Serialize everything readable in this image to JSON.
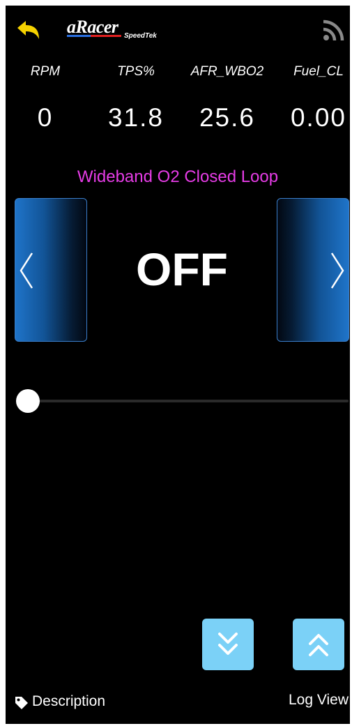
{
  "header": {
    "logo_text": "aRacer",
    "logo_subtext": "SpeedTek",
    "back_icon": "back-arrow-icon",
    "feed_icon": "rss-icon",
    "accent_color": "#f5d200"
  },
  "gauges": [
    {
      "label": "RPM",
      "value": "0"
    },
    {
      "label": "TPS%",
      "value": "31.8"
    },
    {
      "label": "AFR_WBO2",
      "value": "25.6"
    },
    {
      "label": "Fuel_CL",
      "value": "0.00"
    }
  ],
  "setting": {
    "title": "Wideband O2 Closed Loop",
    "title_color": "#e63ce6",
    "value": "OFF",
    "slider_position": 0
  },
  "controls": {
    "page_down_icon": "double-chevron-down-icon",
    "page_up_icon": "double-chevron-up-icon",
    "button_color": "#7bd1f7"
  },
  "footer": {
    "description_label": "Description",
    "description_icon": "tag-icon",
    "logview_label": "Log View"
  }
}
